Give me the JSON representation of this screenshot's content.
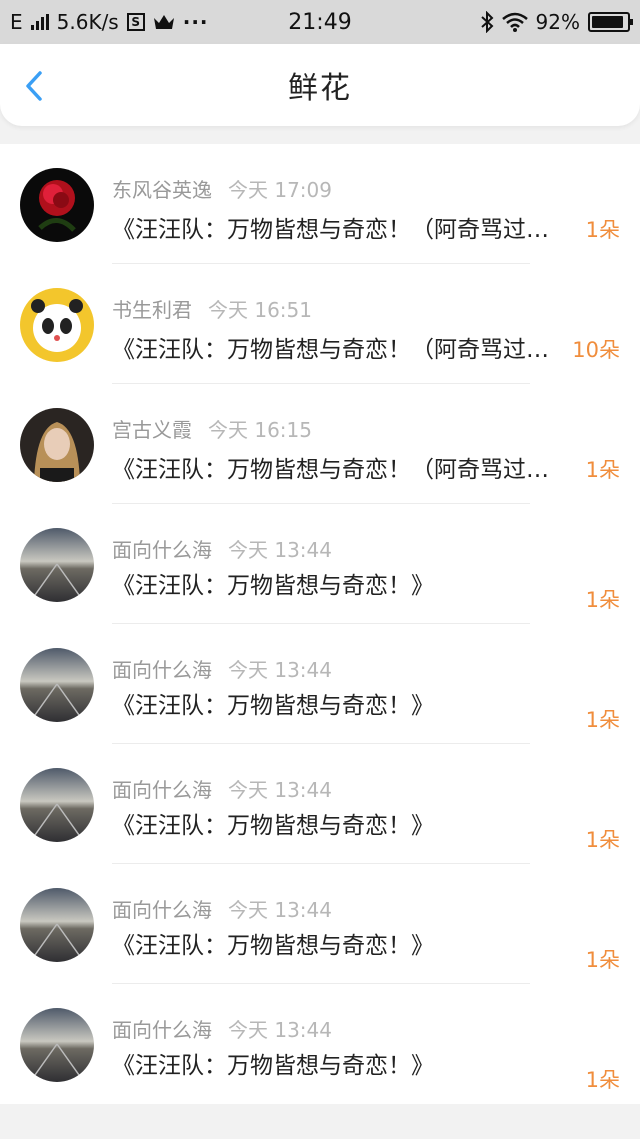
{
  "status_bar": {
    "network": "E",
    "speed": "5.6K/s",
    "time": "21:49",
    "battery": "92%",
    "battery_level": 0.92
  },
  "header": {
    "title": "鲜花"
  },
  "items": [
    {
      "user": "东风谷英逸",
      "time": "今天 17:09",
      "text": "《汪汪队：万物皆想与奇恋！（阿奇骂过…",
      "count": "1朵",
      "avatar": "rose"
    },
    {
      "user": "书生利君",
      "time": "今天 16:51",
      "text": "《汪汪队：万物皆想与奇恋！（阿奇骂过…",
      "count": "10朵",
      "avatar": "panda"
    },
    {
      "user": "宫古义霞",
      "time": "今天 16:15",
      "text": "《汪汪队：万物皆想与奇恋！（阿奇骂过…",
      "count": "1朵",
      "avatar": "portrait"
    },
    {
      "user": "面向什么海",
      "time": "今天 13:44",
      "text": "《汪汪队：万物皆想与奇恋！》",
      "count": "1朵",
      "avatar": "road"
    },
    {
      "user": "面向什么海",
      "time": "今天 13:44",
      "text": "《汪汪队：万物皆想与奇恋！》",
      "count": "1朵",
      "avatar": "road"
    },
    {
      "user": "面向什么海",
      "time": "今天 13:44",
      "text": "《汪汪队：万物皆想与奇恋！》",
      "count": "1朵",
      "avatar": "road"
    },
    {
      "user": "面向什么海",
      "time": "今天 13:44",
      "text": "《汪汪队：万物皆想与奇恋！》",
      "count": "1朵",
      "avatar": "road"
    },
    {
      "user": "面向什么海",
      "time": "今天 13:44",
      "text": "《汪汪队：万物皆想与奇恋！》",
      "count": "1朵",
      "avatar": "road"
    }
  ],
  "colors": {
    "accent": "#3a9ff5",
    "count": "#f08d3c"
  }
}
